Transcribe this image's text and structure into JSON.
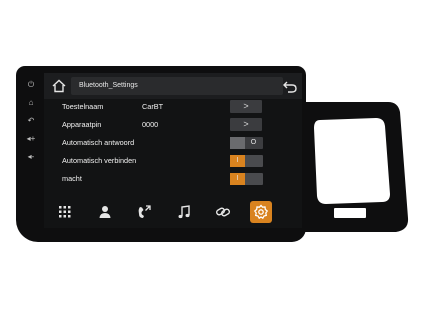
{
  "header": {
    "title": "Bluetooth_Settings"
  },
  "settings": [
    {
      "label": "Toestelnaam",
      "value": "CarBT",
      "control": "arrow"
    },
    {
      "label": "Apparaatpin",
      "value": "0000",
      "control": "arrow"
    },
    {
      "label": "Automatisch antwoord",
      "value": "",
      "control": "toggle",
      "state": "off"
    },
    {
      "label": "Automatisch verbinden",
      "value": "",
      "control": "toggle",
      "state": "on"
    },
    {
      "label": "macht",
      "value": "",
      "control": "toggle",
      "state": "on"
    }
  ],
  "controls": {
    "arrow_glyph": ">",
    "toggle_on_glyph": "I",
    "toggle_off_glyph": "O"
  },
  "colors": {
    "accent": "#d9831f",
    "screen_bg": "#121314",
    "text": "#f1f1f1"
  },
  "dock": [
    {
      "icon": "dialpad-icon"
    },
    {
      "icon": "contacts-icon"
    },
    {
      "icon": "call-log-icon"
    },
    {
      "icon": "music-icon"
    },
    {
      "icon": "link-icon"
    },
    {
      "icon": "settings-icon",
      "active": true
    }
  ],
  "side_icons": [
    "power-icon",
    "home-icon",
    "back-icon",
    "volume-up-icon",
    "volume-down-icon"
  ]
}
